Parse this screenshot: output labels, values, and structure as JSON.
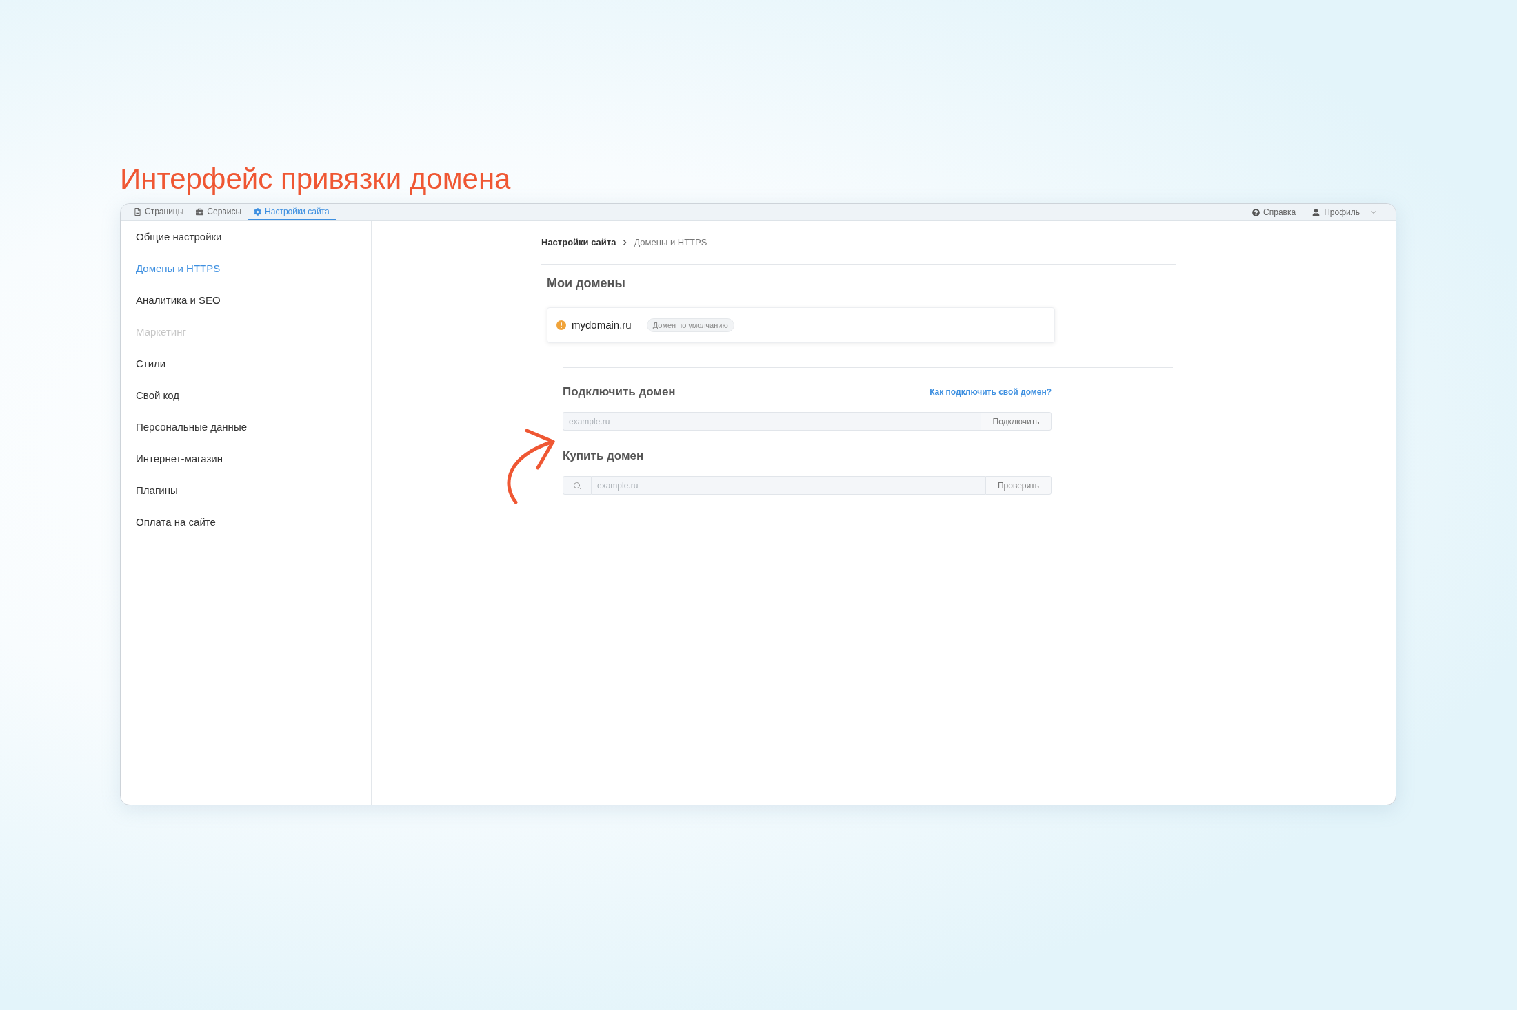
{
  "heading": "Интерфейс привязки домена",
  "tabs": [
    {
      "label": "Страницы",
      "selected": false
    },
    {
      "label": "Сервисы",
      "selected": false
    },
    {
      "label": "Настройки сайта",
      "selected": true
    }
  ],
  "top_links": {
    "help": "Справка",
    "profile": "Профиль"
  },
  "sidebar": {
    "items": [
      {
        "label": "Общие настройки",
        "selected": false,
        "disabled": false
      },
      {
        "label": "Домены и HTTPS",
        "selected": true,
        "disabled": false
      },
      {
        "label": "Аналитика и SEO",
        "selected": false,
        "disabled": false
      },
      {
        "label": "Маркетинг",
        "selected": false,
        "disabled": true
      },
      {
        "label": "Стили",
        "selected": false,
        "disabled": false
      },
      {
        "label": "Свой код",
        "selected": false,
        "disabled": false
      },
      {
        "label": "Персональные данные",
        "selected": false,
        "disabled": false
      },
      {
        "label": "Интернет-магазин",
        "selected": false,
        "disabled": false
      },
      {
        "label": "Плагины",
        "selected": false,
        "disabled": false
      },
      {
        "label": "Оплата на сайте",
        "selected": false,
        "disabled": false
      }
    ]
  },
  "breadcrumb": [
    "Настройки сайта",
    "Домены и HTTPS"
  ],
  "my_domains": {
    "title": "Мои домены",
    "domains": [
      {
        "name": "mydomain.ru",
        "warning": true,
        "badge": "Домен по умолчанию"
      }
    ]
  },
  "connect": {
    "title": "Подключить домен",
    "help_link": "Как подключить свой домен?",
    "placeholder": "example.ru",
    "button": "Подключить"
  },
  "buy": {
    "title": "Купить домен",
    "placeholder": "example.ru",
    "button": "Проверить"
  }
}
